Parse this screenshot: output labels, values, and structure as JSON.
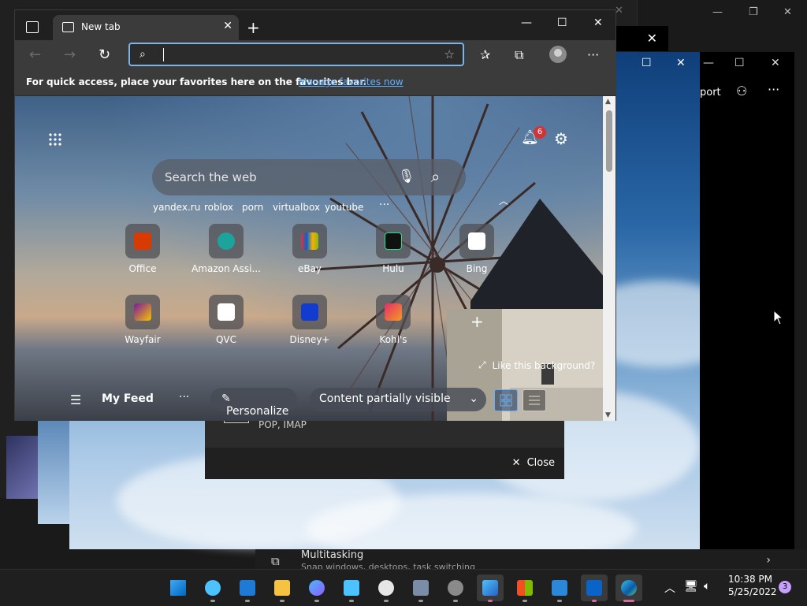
{
  "browser": {
    "tab_title": "New tab",
    "address_value": "",
    "favbar_message": "For quick access, place your favorites here on the favorites bar.",
    "favbar_link": "Manage favorites now"
  },
  "ntp": {
    "search_placeholder": "Search the web",
    "notification_count": "6",
    "quick_links": [
      "yandex.ru",
      "roblox",
      "porn",
      "virtualbox",
      "youtube"
    ],
    "tiles": [
      {
        "label": "Office",
        "color": "#d83b01"
      },
      {
        "label": "Amazon Assi...",
        "color": "#1ba39c"
      },
      {
        "label": "eBay",
        "color": "#e53238"
      },
      {
        "label": "Hulu",
        "color": "#1ce783"
      },
      {
        "label": "Bing",
        "color": "#ffffff"
      },
      {
        "label": "Wayfair",
        "color": "#7b189f"
      },
      {
        "label": "QVC",
        "color": "#ffffff"
      },
      {
        "label": "Disney+",
        "color": "#113ccf"
      },
      {
        "label": "Kohl's",
        "color": "#e52d6b"
      }
    ],
    "like_background": "Like this background?",
    "feed": {
      "title": "My Feed",
      "personalize": "Personalize",
      "visibility": "Content partially visible"
    }
  },
  "background": {
    "support_fragment": "port",
    "pop_imap": "POP, IMAP",
    "close_label": "Close",
    "multitasking_title": "Multitasking",
    "multitasking_sub": "Snap windows, desktops, task switching"
  },
  "taskbar": {
    "time": "10:38 PM",
    "date": "5/25/2022",
    "notification_badge": "3"
  },
  "colors": {
    "accent": "#62b0ff",
    "taskbar": "#1f1f1f",
    "window": "#202020"
  }
}
